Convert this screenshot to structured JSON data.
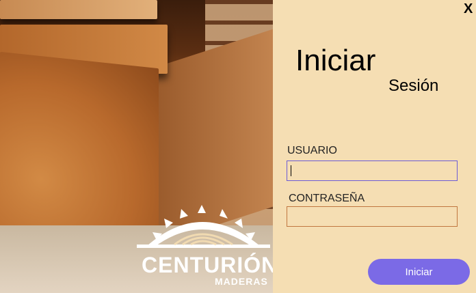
{
  "window": {
    "close_label": "X"
  },
  "brand": {
    "name": "CENTURIÓN",
    "sub": "MADERAS"
  },
  "login": {
    "title_main": "Iniciar",
    "title_sub": "Sesión",
    "username_label": "USUARIO",
    "username_value": "",
    "password_label": "CONTRASEÑA",
    "password_value": "",
    "submit_label": "Iniciar"
  },
  "colors": {
    "panel": "#f5deb3",
    "accent": "#7b6ae6",
    "user_border": "#6b5bd6",
    "pass_border": "#c0763f"
  }
}
